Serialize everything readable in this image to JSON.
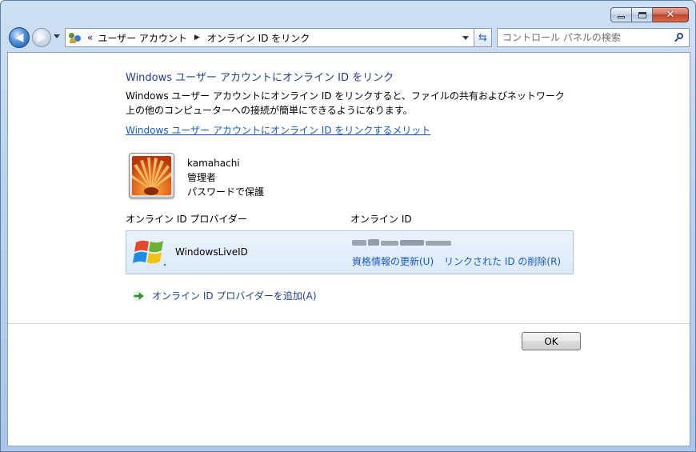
{
  "window": {
    "caption_buttons": {
      "close_glyph": "✕"
    }
  },
  "nav": {
    "back_glyph": "◀",
    "forward_glyph": "▶",
    "address": {
      "overflow": "«",
      "crumbs": [
        "ユーザー アカウント",
        "オンライン ID をリンク"
      ],
      "crumb_arrow": "▶"
    },
    "refresh_glyph": "⇆",
    "search": {
      "placeholder": "コントロール パネルの検索"
    }
  },
  "main": {
    "title": "Windows ユーザー アカウントにオンライン ID をリンク",
    "description_line1": "Windows ユーザー アカウントにオンライン ID をリンクすると、ファイルの共有およびネットワーク",
    "description_line2": "上の他のコンピューターへの接続が簡単にできるようになります。",
    "benefit_link": "Windows ユーザー アカウントにオンライン ID をリンクするメリット",
    "user": {
      "name": "kamahachi",
      "role": "管理者",
      "status": "パスワードで保護"
    },
    "columns": {
      "provider": "オンライン ID プロバイダー",
      "online_id": "オンライン ID"
    },
    "provider": {
      "name": "WindowsLiveID",
      "update_link": "資格情報の更新(U)",
      "unlink_link": "リンクされた ID の削除(R)"
    },
    "add_provider": "オンライン ID プロバイダーを追加(A)",
    "ok_label": "OK"
  }
}
